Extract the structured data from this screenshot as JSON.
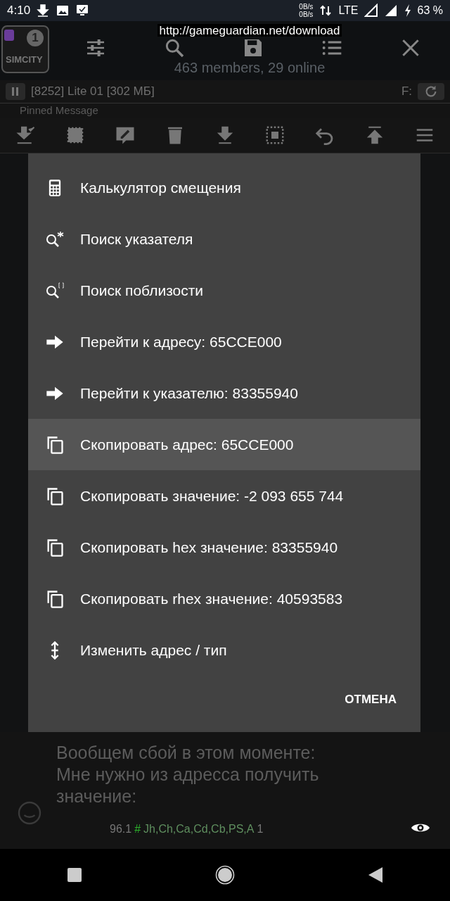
{
  "status_bar": {
    "time": "4:10",
    "net_up": "0B/s",
    "net_down": "0B/s",
    "network": "LTE",
    "battery": "63 %"
  },
  "overlay": {
    "badge": "1",
    "app_label": "SIMCITY",
    "url": "http://gameguardian.net/download",
    "members": "463 members, 29 online",
    "pinned": "Pinned Message"
  },
  "process": {
    "label": "[8252] Lite 01 [302 МБ]",
    "filter": "F:"
  },
  "menu": {
    "items": [
      {
        "kind": "calculator",
        "label": "Калькулятор смещения",
        "selected": false
      },
      {
        "kind": "pointer-search",
        "label": "Поиск указателя",
        "selected": false
      },
      {
        "kind": "nearby-search",
        "label": "Поиск поблизости",
        "selected": false
      },
      {
        "kind": "goto",
        "label": "Перейти к адресу: 65CCE000",
        "selected": false
      },
      {
        "kind": "goto",
        "label": "Перейти к указателю: 83355940",
        "selected": false
      },
      {
        "kind": "copy",
        "label": "Скопировать адрес: 65CCE000",
        "selected": true
      },
      {
        "kind": "copy",
        "label": "Скопировать значение: -2 093 655 744",
        "selected": false
      },
      {
        "kind": "copy",
        "label": "Скопировать hex значение: 83355940",
        "selected": false
      },
      {
        "kind": "copy",
        "label": "Скопировать rhex значение: 40593583",
        "selected": false
      },
      {
        "kind": "edit-type",
        "label": "Изменить адрес / тип",
        "selected": false
      }
    ],
    "cancel": "ОТМЕНА"
  },
  "message": {
    "text": "Вообщем сбой в этом моменте: Мне нужно из адресса получить значение:"
  },
  "footer": {
    "version": "96.1",
    "hash": "#",
    "tags": "Jh,Ch,Ca,Cd,Cb,PS,A",
    "count": "1"
  }
}
